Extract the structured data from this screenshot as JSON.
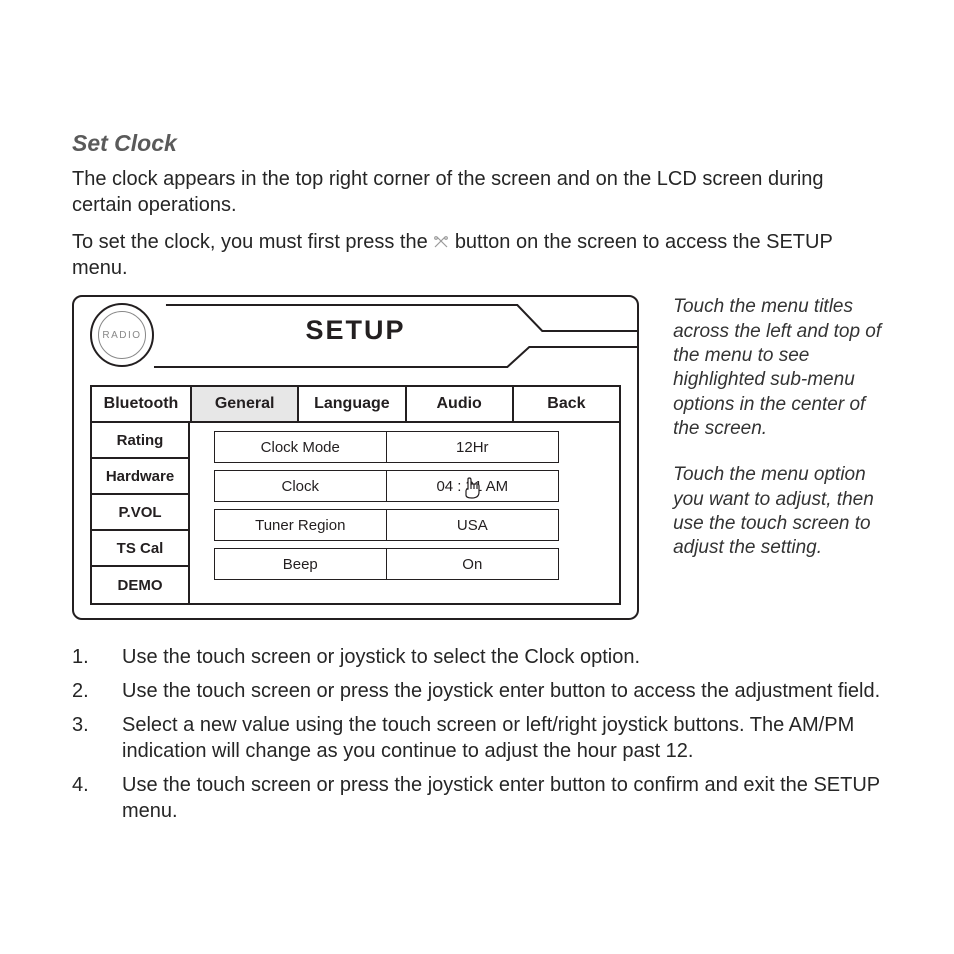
{
  "heading": "Set Clock",
  "intro": {
    "p1": "The clock appears in the top right corner of the screen and on the LCD screen during certain operations.",
    "p2a": "To set the clock, you must first press the ",
    "p2b": " button on the screen to access the SETUP menu."
  },
  "device": {
    "badge": "RADIO",
    "title": "SETUP",
    "left_tabs": [
      "Bluetooth",
      "Rating",
      "Hardware",
      "P.VOL",
      "TS Cal",
      "DEMO"
    ],
    "top_tabs": [
      "General",
      "Language",
      "Audio",
      "Back"
    ],
    "active_top_tab": 0,
    "options": [
      {
        "label": "Clock Mode",
        "value": "12Hr"
      },
      {
        "label": "Clock",
        "value": "04 :   31   AM"
      },
      {
        "label": "Tuner Region",
        "value": "USA"
      },
      {
        "label": "Beep",
        "value": "On"
      }
    ]
  },
  "notes": {
    "n1": "Touch the menu titles across the left and top of the menu to see highlighted sub-menu options in the center of the screen.",
    "n2": "Touch the menu option you want to adjust, then use the touch screen to adjust the setting."
  },
  "steps": [
    "Use the touch screen or joystick to select the Clock option.",
    "Use the touch screen or press the joystick enter button to access the adjustment field.",
    "Select a new value using the touch screen or left/right joystick buttons. The AM/PM indication will change as you continue to adjust the hour past 12.",
    "Use the touch screen or press the joystick enter button to confirm and exit the SETUP menu."
  ]
}
